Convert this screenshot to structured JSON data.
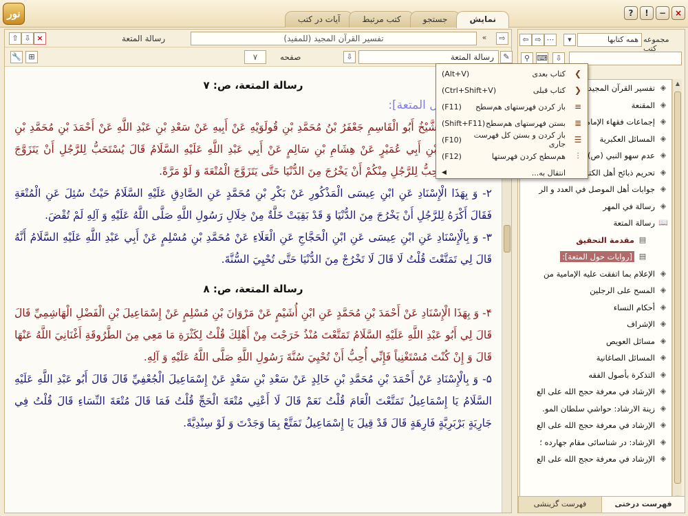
{
  "app": {
    "logo_text": "نور"
  },
  "tabs": [
    "نمایش",
    "جستجو",
    "کتب مرتبط",
    "آیات در کتب"
  ],
  "window_buttons": [
    "?",
    "!",
    "−",
    "×"
  ],
  "main": {
    "nav": {
      "book_selector": "تفسير القرآن المجيد (للمفيد)",
      "current_book": "رسالة المتعة"
    },
    "toolbar": {
      "page_label": "صفحه",
      "page_value": "۷",
      "section_value": "رسالة المتعة"
    },
    "page1_title": "رسالة المتعة، ص: ۷",
    "section_heading": "[روايات حول المتعة]:",
    "paragraphs_page1": [
      {
        "color": "red",
        "text": "۱- أَخْبَرَنِي الشَّيْخُ أَبُو الْقَاسِمِ جَعْفَرُ بْنُ مُحَمَّدِ بْنِ قُولَوَيْهِ عَنْ أَبِيهِ عَنْ سَعْدِ بْنِ عَبْدِ اللَّهِ عَنْ أَحْمَدَ بْنِ مُحَمَّدِ بْنِ عِيسَى عَنِ ابْنِ أَبِي عُمَيْرٍ عَنْ هِشَامِ بْنِ سَالِمٍ عَنْ أَبِي عَبْدِ اللَّهِ عَلَيْهِ السَّلَامُ قَالَ يُسْتَحَبُّ لِلرَّجُلِ أَنْ يَتَزَوَّجَ الْمُتْعَةَ وَ مَا أُحِبُّ لِلرَّجُلِ مِنْكُمْ أَنْ يَخْرُجَ مِنَ الدُّنْيَا حَتَّى يَتَزَوَّجَ الْمُتْعَةَ وَ لَوْ مَرَّةً."
      },
      {
        "color": "blue",
        "text": "۲- وَ بِهَذَا الْإِسْنَادِ عَنِ ابْنِ عِيسَى الْمَذْكُورِ عَنْ بَكْرِ بْنِ مُحَمَّدٍ عَنِ الصَّادِقِ عَلَيْهِ السَّلَامُ حَيْثُ سُئِلَ عَنِ الْمُتْعَةِ فَقَالَ أَكْرَهُ لِلرَّجُلِ أَنْ يَخْرُجَ مِنَ الدُّنْيَا وَ قَدْ بَقِيَتْ خَلَّةٌ مِنْ خِلَالِ رَسُولِ اللَّهِ صَلَّى اللَّهُ عَلَيْهِ وَ آلِهِ لَمْ تُقْضَ."
      },
      {
        "color": "blue",
        "text": "۳- وَ بِالْإِسْنَادِ عَنِ ابْنِ عِيسَى عَنِ ابْنِ الْحَجَّاجِ عَنِ الْعَلَاءِ عَنْ مُحَمَّدِ بْنِ مُسْلِمٍ عَنْ أَبِي عَبْدِ اللَّهِ عَلَيْهِ السَّلَامُ أَنَّهُ قَالَ لِي تَمَتَّعْتَ قُلْتُ لَا قَالَ لَا تَخْرُجْ مِنَ الدُّنْيَا حَتَّى تُحْيِيَ السُّنَّةَ."
      }
    ],
    "page2_title": "رسالة المتعة، ص: ۸",
    "paragraphs_page2": [
      {
        "color": "red",
        "text": "۴- وَ بِهَذَا الْإِسْنَادِ عَنْ أَحْمَدَ بْنِ مُحَمَّدٍ عَنِ ابْنِ أُشَيْمٍ عَنْ مَرْوَانَ بْنِ مُسْلِمٍ عَنْ إِسْمَاعِيلَ بْنِ الْفَضْلِ الْهَاشِمِيِّ قَالَ قَالَ لِي أَبُو عَبْدِ اللَّهِ عَلَيْهِ السَّلَامُ تَمَتَّعْتَ مُنْذُ خَرَجْتَ مِنْ أَهْلِكَ قُلْتُ لِكَثْرَةِ مَا مَعِي مِنَ الطَّرُوقَةِ أَغْنَانِيَ اللَّهُ عَنْهَا قَالَ وَ إِنْ كُنْتَ مُسْتَغْنِياً فَإِنِّي أُحِبُّ أَنْ تُحْيِيَ سُنَّةَ رَسُولِ اللَّهِ صَلَّى اللَّهُ عَلَيْهِ وَ آلِهِ."
      },
      {
        "color": "blue",
        "text": "۵- وَ بِالْإِسْنَادِ عَنْ أَحْمَدَ بْنِ مُحَمَّدِ بْنِ خَالِدٍ عَنْ سَعْدِ بْنِ سَعْدٍ عَنْ إِسْمَاعِيلَ الْجُعْفِيِّ قَالَ قَالَ أَبُو عَبْدِ اللَّهِ عَلَيْهِ السَّلَامُ يَا إِسْمَاعِيلُ تَمَتَّعْتَ الْعَامَ قُلْتُ نَعَمْ قَالَ لَا أَعْنِي مُتْعَةَ الْحَجِّ قُلْتُ فَمَا قَالَ مُتْعَةَ النِّسَاءِ قَالَ قُلْتُ فِي جَارِيَةٍ بَرْبَرِيَّةٍ فَارِهَةٍ قَالَ قَدْ قِيلَ يَا إِسْمَاعِيلُ تَمَتَّعْ بِمَا وَجَدْتَ وَ لَوْ سِنْدِيَّةً."
      }
    ]
  },
  "context_menu": [
    {
      "label": "کتاب بعدی",
      "shortcut": "(Alt+V)",
      "icon": "book-forward-icon"
    },
    {
      "label": "کتاب قبلی",
      "shortcut": "(Ctrl+Shift+V)",
      "icon": "book-back-icon"
    },
    {
      "label": "باز کردن فهرستهای هم‌سطح",
      "shortcut": "(F11)",
      "icon": "expand-level-icon"
    },
    {
      "label": "بستن فهرستهای هم‌سطح",
      "shortcut": "(Shift+F11)",
      "icon": "collapse-level-icon"
    },
    {
      "label": "باز کردن و بستن کل فهرست جاری",
      "shortcut": "(F10)",
      "icon": "toggle-all-icon"
    },
    {
      "label": "هم‌سطح کردن فهرستها",
      "shortcut": "(F12)",
      "icon": "align-level-icon"
    },
    {
      "label": "انتقال به...",
      "shortcut": "",
      "icon": "goto-icon",
      "submenu": true
    }
  ],
  "right": {
    "collection_label": "مجموعه کتب",
    "collection_value": "همه کتابها",
    "tree": [
      {
        "label": "تفسير القرآن المجيد (للمفيد)",
        "level": 0
      },
      {
        "label": "المقنعة",
        "level": 0
      },
      {
        "label": "إجماعات فقهاء الإمامية",
        "level": 0
      },
      {
        "label": "المسائل العكبرية",
        "level": 0
      },
      {
        "label": "عدم سهو النبي (ص)",
        "level": 0
      },
      {
        "label": "تحريم ذبائح أهل الكتاب",
        "level": 0
      },
      {
        "label": "جوابات أهل الموصل في العدد و الر",
        "level": 0
      },
      {
        "label": "رسالة في المهر",
        "level": 0
      },
      {
        "label": "رسالة المتعة",
        "level": 0,
        "open": true
      },
      {
        "label": "مقدمة التحقيق",
        "level": 1,
        "style": "bold"
      },
      {
        "label": "[روايات حول المتعة]:",
        "level": 1,
        "style": "selected"
      },
      {
        "label": "الإعلام بما اتفقت عليه الإمامية من",
        "level": 0
      },
      {
        "label": "المسح على الرجلين",
        "level": 0
      },
      {
        "label": "أحكام النساء",
        "level": 0
      },
      {
        "label": "الإشراف",
        "level": 0
      },
      {
        "label": "مسائل العويص",
        "level": 0
      },
      {
        "label": "المسائل الصاغانية",
        "level": 0
      },
      {
        "label": "التذكرة بأصول الفقه",
        "level": 0
      },
      {
        "label": "الإرشاد في معرفة حجج الله على الع",
        "level": 0
      },
      {
        "label": "زينة الارشاد: حواشي سلطان المو.",
        "level": 0
      },
      {
        "label": "الإرشاد في معرفة حجج الله على الع",
        "level": 0
      },
      {
        "label": "الإرشاد: در شناسائى مقام جهارده ؛",
        "level": 0
      },
      {
        "label": "الإرشاد في معرفة حجج الله على الع",
        "level": 0
      }
    ],
    "bottom_tabs": [
      "فهرست درختی",
      "فهرست گزینشی"
    ]
  }
}
